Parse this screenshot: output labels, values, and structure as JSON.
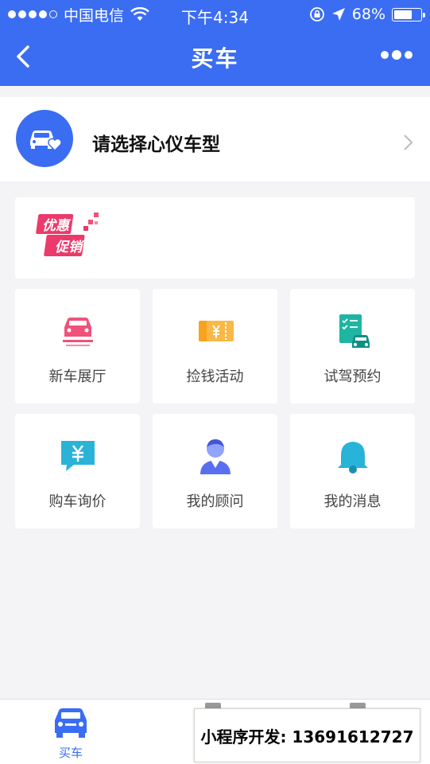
{
  "status_bar": {
    "carrier": "中国电信",
    "time": "下午4:34",
    "battery": "68%",
    "battery_level": 0.68
  },
  "nav": {
    "title": "买车"
  },
  "select_car": {
    "label": "请选择心仪车型"
  },
  "promo": {
    "logo_line1": "优惠",
    "logo_line2": "促销"
  },
  "grid": [
    {
      "label": "新车展厅",
      "icon": "car-front-icon",
      "color": "#f0527a"
    },
    {
      "label": "捡钱活动",
      "icon": "coupon-yuan-icon",
      "color": "#f7a31e"
    },
    {
      "label": "试驾预约",
      "icon": "checklist-car-icon",
      "color": "#1fb5a3"
    },
    {
      "label": "购车询价",
      "icon": "yuan-chat-icon",
      "color": "#2bb3d7"
    },
    {
      "label": "我的顾问",
      "icon": "advisor-icon",
      "color": "#5a6ff0"
    },
    {
      "label": "我的消息",
      "icon": "bell-icon",
      "color": "#28b3d8"
    }
  ],
  "tabbar": {
    "tab1_label": "买车",
    "accent": "#3b6df2"
  },
  "watermark": {
    "text": "小程序开发: 13691612727"
  }
}
